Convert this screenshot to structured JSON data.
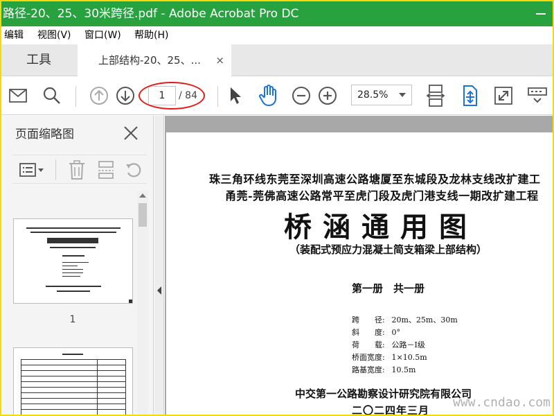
{
  "window": {
    "title": "路径-20、25、30米跨径.pdf - Adobe Acrobat Pro DC"
  },
  "menu": {
    "items": [
      "编辑",
      "视图(V)",
      "窗口(W)",
      "帮助(H)"
    ]
  },
  "tabs": {
    "tools_label": "工具",
    "doc_label": "上部结构-20、25、...",
    "close_glyph": "×"
  },
  "toolbar": {
    "page_current": "1",
    "page_total": "/ 84",
    "zoom": "28.5%"
  },
  "sidepanel": {
    "title": "页面缩略图",
    "thumb1_label": "1"
  },
  "document": {
    "line1": "珠三角环线东莞至深圳高速公路塘厦至东城段及龙林支线改扩建工",
    "line2": "甬莞-莞佛高速公路常平至虎门段及虎门港支线一期改扩建工程",
    "main_title": "桥涵通用图",
    "subtitle": "（装配式预应力混凝土简支箱梁上部结构）",
    "volume": "第一册　共一册",
    "specs": [
      {
        "key": "跨　　径:",
        "value": "20m、25m、30m"
      },
      {
        "key": "斜　　度:",
        "value": "0°"
      },
      {
        "key": "荷　　载:",
        "value": "公路－Ⅰ级"
      },
      {
        "key": "桥面宽度:",
        "value": "1×10.5m"
      },
      {
        "key": "路基宽度:",
        "value": "10.5m"
      }
    ],
    "institute": "中交第一公路勘察设计研究院有限公司",
    "date": "二〇二四年三月"
  },
  "watermark": "www.cndao.com",
  "colors": {
    "titlebar": "#27a23f",
    "highlight_circle": "#e01818",
    "frame_border": "#f5d90a",
    "accent_blue": "#1a73d8"
  }
}
